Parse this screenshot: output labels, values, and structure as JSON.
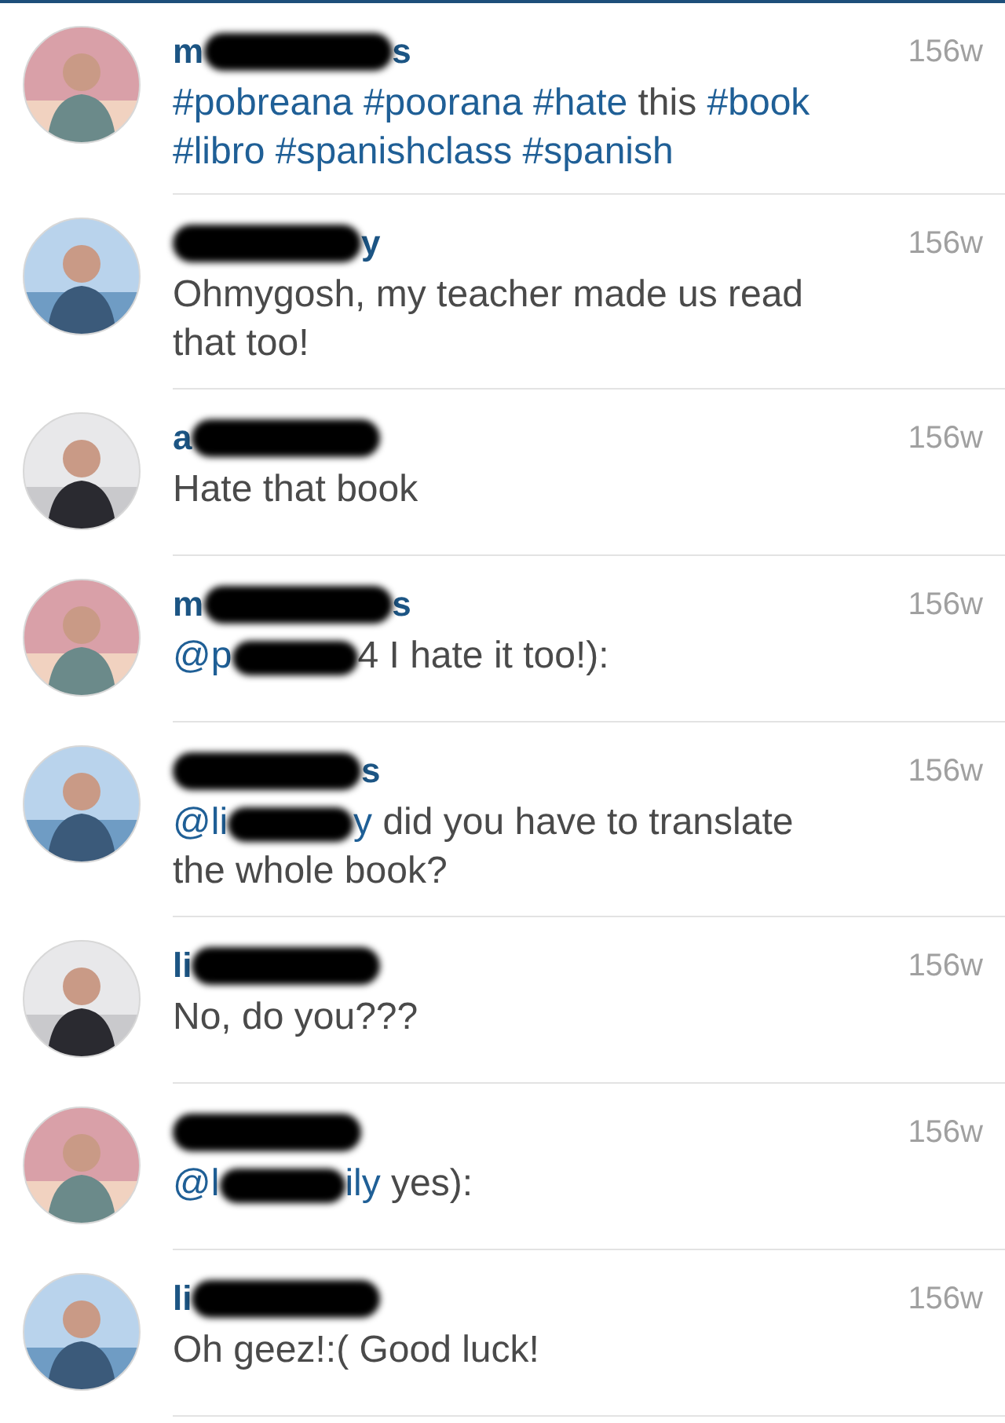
{
  "comments": [
    {
      "username": [
        {
          "kind": "text",
          "text": "m"
        },
        {
          "kind": "redaction"
        },
        {
          "kind": "text",
          "text": "s"
        }
      ],
      "time": "156w",
      "lines": [
        [
          {
            "kind": "tag",
            "text": "#pobreana #poorana #hate"
          },
          {
            "kind": "text",
            "text": " this "
          },
          {
            "kind": "tag",
            "text": "#book"
          }
        ],
        [
          {
            "kind": "tag",
            "text": "#libro #spanishclass #spanish"
          }
        ]
      ]
    },
    {
      "username": [
        {
          "kind": "redaction"
        },
        {
          "kind": "text",
          "text": "y"
        }
      ],
      "time": "156w",
      "lines": [
        [
          {
            "kind": "text",
            "text": "Ohmygosh, my teacher made us read"
          }
        ],
        [
          {
            "kind": "text",
            "text": "that too!"
          }
        ]
      ]
    },
    {
      "username": [
        {
          "kind": "text",
          "text": "a"
        },
        {
          "kind": "redaction"
        }
      ],
      "time": "156w",
      "lines": [
        [
          {
            "kind": "text",
            "text": "Hate that book"
          }
        ]
      ]
    },
    {
      "username": [
        {
          "kind": "text",
          "text": "m"
        },
        {
          "kind": "redaction"
        },
        {
          "kind": "text",
          "text": "s"
        }
      ],
      "time": "156w",
      "lines": [
        [
          {
            "kind": "tag",
            "text": "@p"
          },
          {
            "kind": "redaction"
          },
          {
            "kind": "text",
            "text": "4 I hate it too!):"
          }
        ]
      ]
    },
    {
      "username": [
        {
          "kind": "redaction"
        },
        {
          "kind": "text",
          "text": "s"
        }
      ],
      "time": "156w",
      "lines": [
        [
          {
            "kind": "tag",
            "text": "@li"
          },
          {
            "kind": "redaction"
          },
          {
            "kind": "tag",
            "text": "y"
          },
          {
            "kind": "text",
            "text": " did you have to translate"
          }
        ],
        [
          {
            "kind": "text",
            "text": "the whole book?"
          }
        ]
      ]
    },
    {
      "username": [
        {
          "kind": "text",
          "text": "li"
        },
        {
          "kind": "redaction"
        }
      ],
      "time": "156w",
      "lines": [
        [
          {
            "kind": "text",
            "text": "No, do you???"
          }
        ]
      ]
    },
    {
      "username": [
        {
          "kind": "redaction"
        }
      ],
      "time": "156w",
      "lines": [
        [
          {
            "kind": "tag",
            "text": "@l"
          },
          {
            "kind": "redaction"
          },
          {
            "kind": "tag",
            "text": "ily"
          },
          {
            "kind": "text",
            "text": " yes):"
          }
        ]
      ]
    },
    {
      "username": [
        {
          "kind": "text",
          "text": "li"
        },
        {
          "kind": "redaction"
        }
      ],
      "time": "156w",
      "lines": [
        [
          {
            "kind": "text",
            "text": "Oh geez!:( Good luck!"
          }
        ]
      ]
    }
  ]
}
